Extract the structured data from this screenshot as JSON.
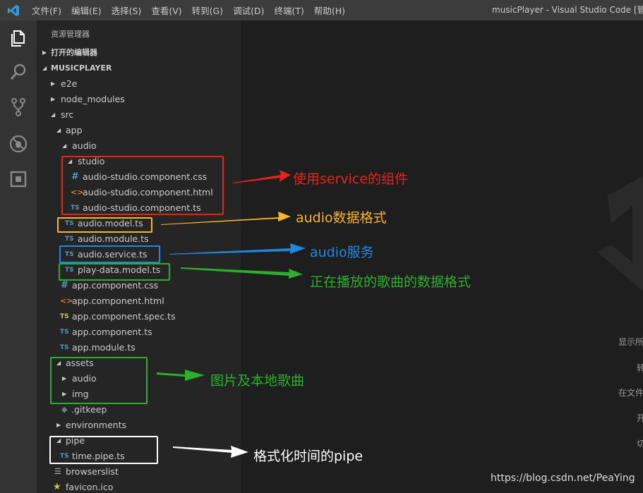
{
  "titlebar": {
    "menu": [
      "文件(F)",
      "编辑(E)",
      "选择(S)",
      "查看(V)",
      "转到(G)",
      "调试(D)",
      "终端(T)",
      "帮助(H)"
    ],
    "title": "musicPlayer - Visual Studio Code [管理员]"
  },
  "activity_icons": [
    "files-icon",
    "search-icon",
    "source-control-icon",
    "debug-icon",
    "extensions-icon"
  ],
  "sidebar": {
    "title": "资源管理器",
    "open_editors": "打开的编辑器",
    "project": "MUSICPLAYER",
    "tree": [
      {
        "label": "e2e",
        "expanded": false
      },
      {
        "label": "node_modules",
        "expanded": false
      },
      {
        "label": "src",
        "expanded": true
      },
      {
        "label": "app",
        "expanded": true
      },
      {
        "label": "audio",
        "expanded": true
      },
      {
        "label": "studio",
        "expanded": true
      },
      {
        "label": "audio-studio.component.css",
        "icon": "#"
      },
      {
        "label": "audio-studio.component.html",
        "icon": "<>"
      },
      {
        "label": "audio-studio.component.ts",
        "icon": "TS"
      },
      {
        "label": "audio.model.ts",
        "icon": "TS"
      },
      {
        "label": "audio.module.ts",
        "icon": "TS"
      },
      {
        "label": "audio.service.ts",
        "icon": "TS"
      },
      {
        "label": "play-data.model.ts",
        "icon": "TS"
      },
      {
        "label": "app.component.css",
        "icon": "#"
      },
      {
        "label": "app.component.html",
        "icon": "<>"
      },
      {
        "label": "app.component.spec.ts",
        "icon": "TS"
      },
      {
        "label": "app.component.ts",
        "icon": "TS"
      },
      {
        "label": "app.module.ts",
        "icon": "TS"
      },
      {
        "label": "assets",
        "expanded": true
      },
      {
        "label": "audio",
        "expanded": false
      },
      {
        "label": "img",
        "expanded": false
      },
      {
        "label": ".gitkeep"
      },
      {
        "label": "environments",
        "expanded": false
      },
      {
        "label": "pipe",
        "expanded": true
      },
      {
        "label": "time.pipe.ts",
        "icon": "TS"
      },
      {
        "label": "browserslist"
      },
      {
        "label": "favicon.ico"
      }
    ]
  },
  "editor": {
    "hints": [
      "显示所",
      "转",
      "在文件",
      "开",
      "切"
    ]
  },
  "annotations": [
    {
      "text": "使用service的组件",
      "color": "#e8231d"
    },
    {
      "text": "audio数据格式",
      "color": "#f7b52c"
    },
    {
      "text": "audio服务",
      "color": "#1e88e5"
    },
    {
      "text": "正在播放的歌曲的数据格式",
      "color": "#2bb02b"
    },
    {
      "text": "图片及本地歌曲",
      "color": "#2bb02b"
    },
    {
      "text": "格式化时间的pipe",
      "color": "#ffffff"
    }
  ],
  "credit": "https://blog.csdn.net/PeaYing"
}
